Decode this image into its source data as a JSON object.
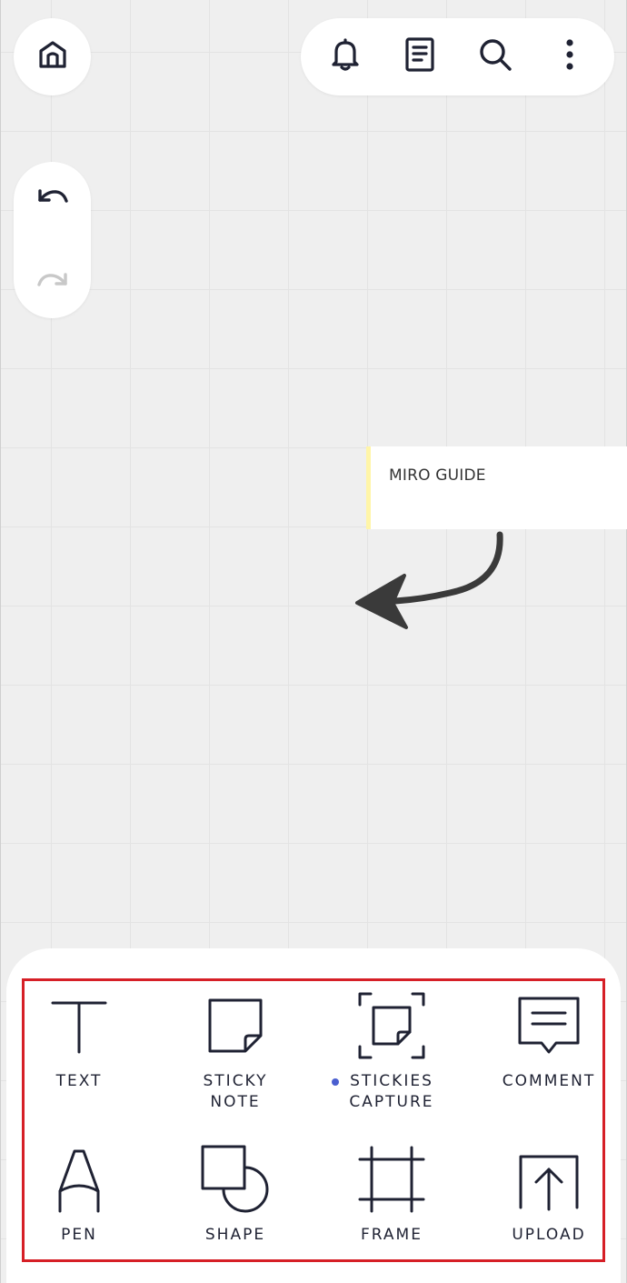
{
  "canvas": {
    "sticky_note_text": "MIRO GUIDE"
  },
  "header": {
    "home_icon": "home-icon",
    "actions": [
      {
        "name": "notifications",
        "icon": "bell-icon"
      },
      {
        "name": "board-info",
        "icon": "document-icon"
      },
      {
        "name": "search",
        "icon": "search-icon"
      },
      {
        "name": "more",
        "icon": "more-vertical-icon"
      }
    ]
  },
  "history": {
    "undo_icon": "undo-icon",
    "redo_icon": "redo-icon",
    "redo_enabled": false
  },
  "toolbar": {
    "highlight_color": "#d61f26",
    "icon_color": "#1f2233",
    "new_badge_color": "#4a5fd0",
    "tools": [
      {
        "label": "TEXT",
        "icon": "text-icon"
      },
      {
        "label": "STICKY\nNOTE",
        "icon": "sticky-note-icon"
      },
      {
        "label": "STICKIES\nCAPTURE",
        "icon": "stickies-capture-icon",
        "badge": "new"
      },
      {
        "label": "COMMENT",
        "icon": "comment-icon"
      },
      {
        "label": "PEN",
        "icon": "pen-icon"
      },
      {
        "label": "SHAPE",
        "icon": "shape-icon"
      },
      {
        "label": "FRAME",
        "icon": "frame-icon"
      },
      {
        "label": "UPLOAD",
        "icon": "upload-icon"
      }
    ]
  }
}
